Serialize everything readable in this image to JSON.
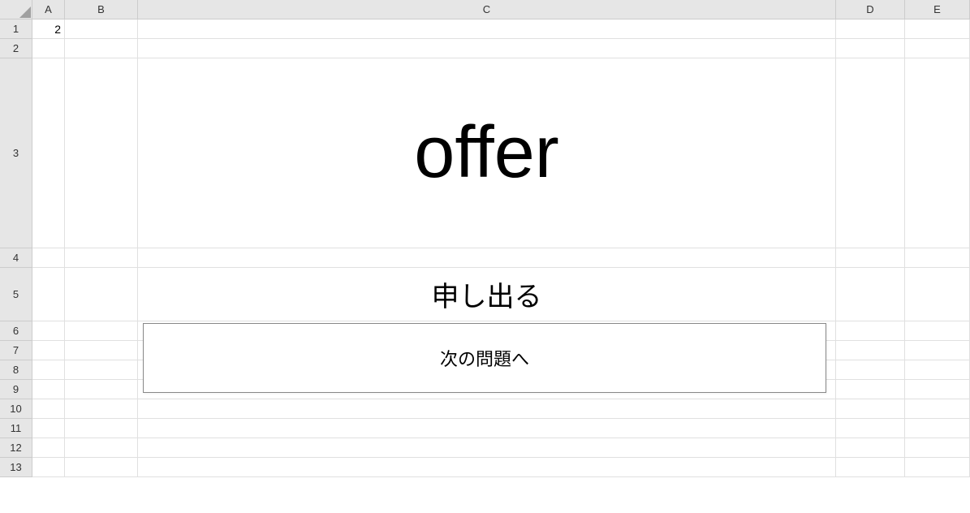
{
  "columns": [
    "A",
    "B",
    "C",
    "D",
    "E"
  ],
  "rows": [
    "1",
    "2",
    "3",
    "4",
    "5",
    "6",
    "7",
    "8",
    "9",
    "10",
    "11",
    "12",
    "13"
  ],
  "cells": {
    "A1": "2",
    "C3": "offer",
    "C5": "申し出る"
  },
  "button": {
    "next_label": "次の問題へ"
  }
}
